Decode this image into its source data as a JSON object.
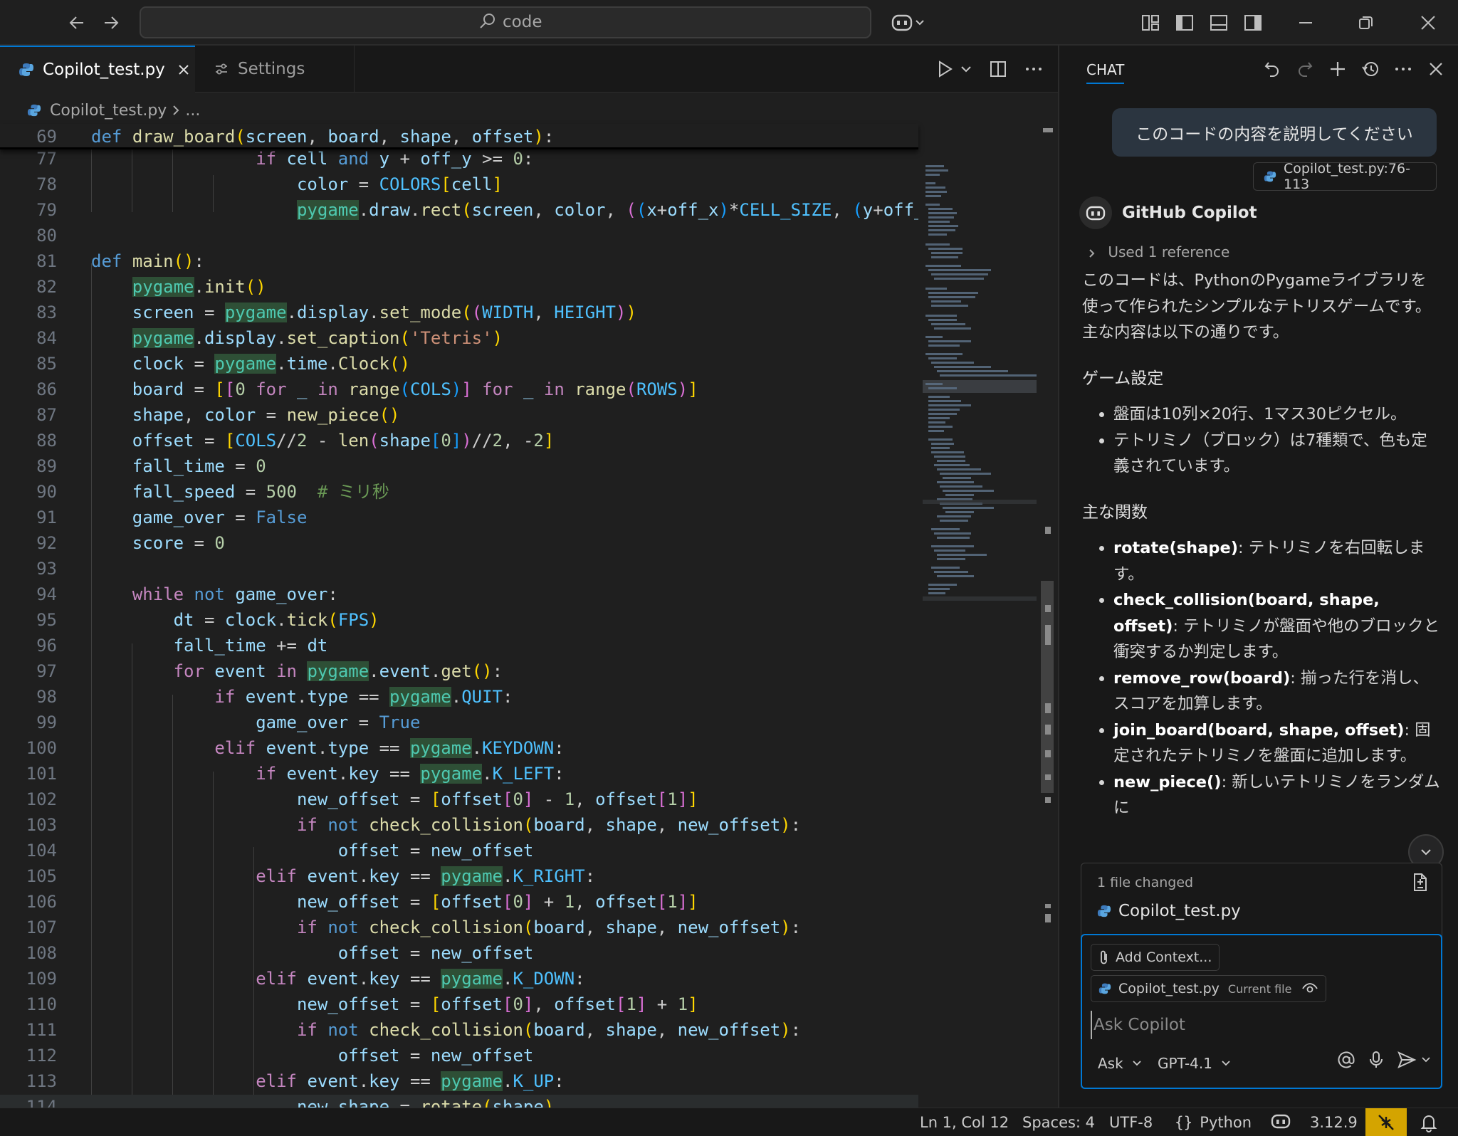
{
  "titlebar": {
    "search_text": "code"
  },
  "editor": {
    "tabs": [
      {
        "label": "Copilot_test.py",
        "active": true
      },
      {
        "label": "Settings",
        "active": false
      }
    ],
    "breadcrumb": {
      "file": "Copilot_test.py",
      "rest": "..."
    },
    "sticky_line": {
      "number": "69"
    },
    "line_numbers": [
      "77",
      "78",
      "79",
      "80",
      "81",
      "82",
      "83",
      "84",
      "85",
      "86",
      "87",
      "88",
      "89",
      "90",
      "91",
      "92",
      "93",
      "94",
      "95",
      "96",
      "97",
      "98",
      "99",
      "100",
      "101",
      "102",
      "103",
      "104",
      "105",
      "106",
      "107",
      "108",
      "109",
      "110",
      "111",
      "112",
      "113",
      "114"
    ]
  },
  "chat": {
    "title": "CHAT",
    "user_message": "このコードの内容を説明してください",
    "user_reference": "Copilot_test.py:76-113",
    "assistant_name": "GitHub Copilot",
    "used_reference": "Used 1 reference",
    "answer": {
      "intro_1": "このコードは、PythonのPygameライブラリを使って作られたシンプルなテトリスゲームです。",
      "intro_2": "主な内容は以下の通りです。",
      "heading_settings": "ゲーム設定",
      "settings_items": [
        "盤面は10列×20行、1マス30ピクセル。",
        "テトリミノ（ブロック）は7種類で、色も定義されています。"
      ],
      "heading_functions": "主な関数",
      "functions": [
        {
          "name": "rotate(shape)",
          "desc": ": テトリミノを右回転します。"
        },
        {
          "name": "check_collision(board, shape, offset)",
          "desc": ": テトリミノが盤面や他のブロックと衝突するか判定します。"
        },
        {
          "name": "remove_row(board)",
          "desc": ": 揃った行を消し、スコアを加算します。"
        },
        {
          "name": "join_board(board, shape, offset)",
          "desc": ": 固定されたテトリミノを盤面に追加します。"
        },
        {
          "name": "new_piece()",
          "desc": ": 新しいテトリミノをランダムに"
        }
      ]
    },
    "files_changed": {
      "label": "1 file changed",
      "file": "Copilot_test.py"
    },
    "input": {
      "add_context": "Add Context...",
      "current_file_name": "Copilot_test.py",
      "current_file_tag": "Current file",
      "placeholder": "Ask Copilot",
      "mode": "Ask",
      "model": "GPT-4.1"
    }
  },
  "statusbar": {
    "position": "Ln 1, Col 12",
    "spaces": "Spaces: 4",
    "encoding": "UTF-8",
    "language": "Python",
    "python_version": "3.12.9"
  }
}
